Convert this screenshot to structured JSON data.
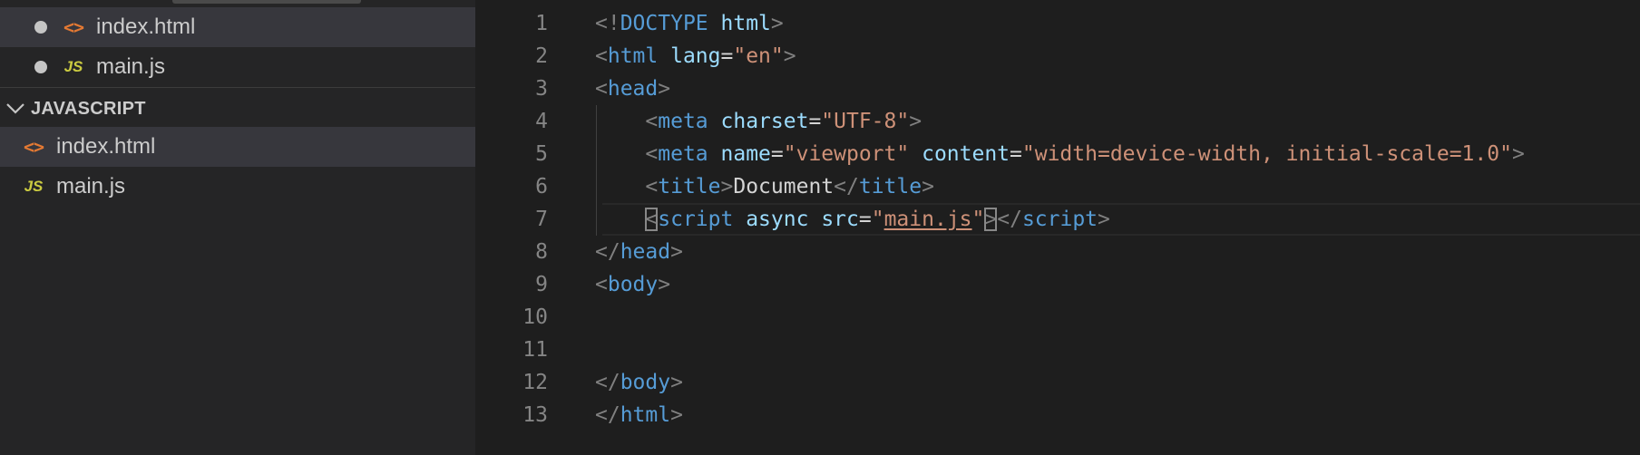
{
  "sidebar": {
    "open_editors": [
      {
        "name": "index.html",
        "icon": "html-file-icon"
      },
      {
        "name": "main.js",
        "icon": "js-file-icon",
        "icon_label": "JS"
      }
    ],
    "section_title": "JAVASCRIPT",
    "files": [
      {
        "name": "index.html",
        "icon": "html-file-icon"
      },
      {
        "name": "main.js",
        "icon": "js-file-icon",
        "icon_label": "JS"
      }
    ]
  },
  "editor": {
    "lines": [
      {
        "n": "1",
        "tokens": [
          [
            "<!",
            "punc"
          ],
          [
            "DOCTYPE",
            "tag"
          ],
          [
            " ",
            "text"
          ],
          [
            "html",
            "attr"
          ],
          [
            ">",
            "punc"
          ]
        ]
      },
      {
        "n": "2",
        "tokens": [
          [
            "<",
            "punc"
          ],
          [
            "html",
            "tag"
          ],
          [
            " ",
            "text"
          ],
          [
            "lang",
            "attr"
          ],
          [
            "=",
            "text"
          ],
          [
            "\"en\"",
            "str"
          ],
          [
            ">",
            "punc"
          ]
        ]
      },
      {
        "n": "3",
        "tokens": [
          [
            "<",
            "punc"
          ],
          [
            "head",
            "tag"
          ],
          [
            ">",
            "punc"
          ]
        ]
      },
      {
        "n": "4",
        "tokens": [
          [
            "    ",
            "text"
          ],
          [
            "<",
            "punc"
          ],
          [
            "meta",
            "tag"
          ],
          [
            " ",
            "text"
          ],
          [
            "charset",
            "attr"
          ],
          [
            "=",
            "text"
          ],
          [
            "\"UTF-8\"",
            "str"
          ],
          [
            ">",
            "punc"
          ]
        ]
      },
      {
        "n": "5",
        "tokens": [
          [
            "    ",
            "text"
          ],
          [
            "<",
            "punc"
          ],
          [
            "meta",
            "tag"
          ],
          [
            " ",
            "text"
          ],
          [
            "name",
            "attr"
          ],
          [
            "=",
            "text"
          ],
          [
            "\"viewport\"",
            "str"
          ],
          [
            " ",
            "text"
          ],
          [
            "content",
            "attr"
          ],
          [
            "=",
            "text"
          ],
          [
            "\"width=device-width, initial-scale=1.0\"",
            "str"
          ],
          [
            ">",
            "punc"
          ]
        ]
      },
      {
        "n": "6",
        "tokens": [
          [
            "    ",
            "text"
          ],
          [
            "<",
            "punc"
          ],
          [
            "title",
            "tag"
          ],
          [
            ">",
            "punc"
          ],
          [
            "Document",
            "text"
          ],
          [
            "</",
            "punc"
          ],
          [
            "title",
            "tag"
          ],
          [
            ">",
            "punc"
          ]
        ]
      },
      {
        "n": "7",
        "current": true,
        "tokens": [
          [
            "    ",
            "text"
          ],
          [
            "<",
            "punc-box"
          ],
          [
            "script",
            "tag"
          ],
          [
            " ",
            "text"
          ],
          [
            "async",
            "attr"
          ],
          [
            " ",
            "text"
          ],
          [
            "src",
            "attr"
          ],
          [
            "=",
            "text"
          ],
          [
            "\"",
            "str"
          ],
          [
            "main.js",
            "str-link"
          ],
          [
            "\"",
            "str"
          ],
          [
            ">",
            "punc-box"
          ],
          [
            "</",
            "punc"
          ],
          [
            "script",
            "tag"
          ],
          [
            ">",
            "punc"
          ]
        ]
      },
      {
        "n": "8",
        "tokens": [
          [
            "</",
            "punc"
          ],
          [
            "head",
            "tag"
          ],
          [
            ">",
            "punc"
          ]
        ]
      },
      {
        "n": "9",
        "tokens": [
          [
            "<",
            "punc"
          ],
          [
            "body",
            "tag"
          ],
          [
            ">",
            "punc"
          ]
        ]
      },
      {
        "n": "10",
        "tokens": []
      },
      {
        "n": "11",
        "tokens": []
      },
      {
        "n": "12",
        "tokens": [
          [
            "</",
            "punc"
          ],
          [
            "body",
            "tag"
          ],
          [
            ">",
            "punc"
          ]
        ]
      },
      {
        "n": "13",
        "tokens": [
          [
            "</",
            "punc"
          ],
          [
            "html",
            "tag"
          ],
          [
            ">",
            "punc"
          ]
        ]
      }
    ]
  }
}
